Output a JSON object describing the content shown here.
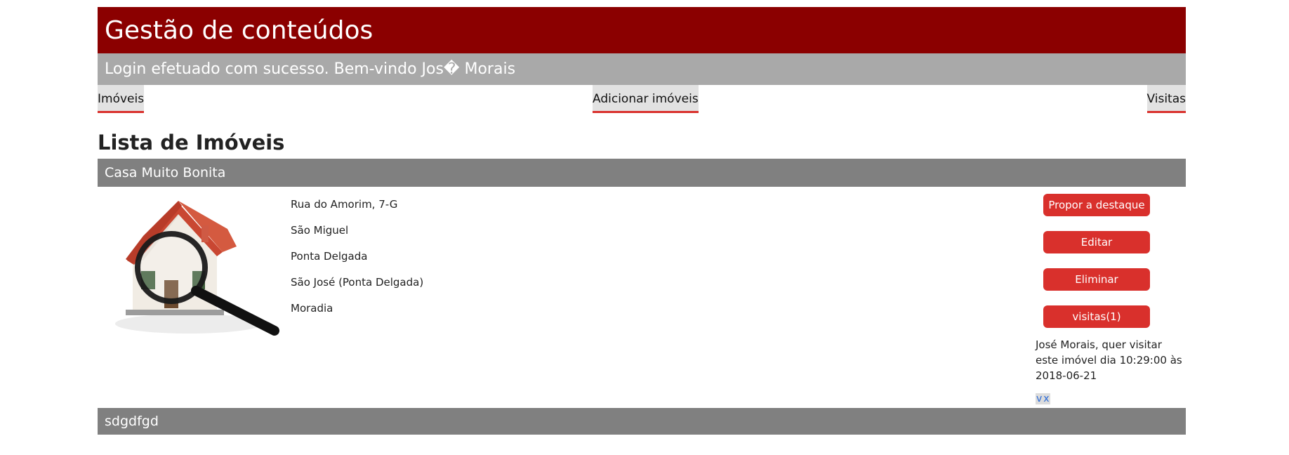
{
  "header": {
    "title": "Gestão de conteúdos"
  },
  "subheader": {
    "message": "Login efetuado com sucesso. Bem-vindo Jos� Morais"
  },
  "nav": {
    "items": [
      {
        "label": "Imóveis"
      },
      {
        "label": "Adicionar imóveis"
      },
      {
        "label": "Visitas"
      }
    ]
  },
  "main": {
    "title": "Lista de Imóveis",
    "listings": [
      {
        "title": "Casa Muito Bonita",
        "image": "house-magnifier-image",
        "details": [
          "Rua do Amorim, 7-G",
          "São Miguel",
          "Ponta Delgada",
          "São José (Ponta Delgada)",
          "Moradia"
        ],
        "actions": {
          "highlight": "Propor a destaque",
          "edit": "Editar",
          "delete": "Eliminar",
          "visits": "visitas(1)"
        },
        "visit_note": "José Morais, quer visitar este imóvel dia 10:29:00 às 2018-06-21",
        "visit_controls": {
          "accept": "v",
          "reject": "x"
        }
      },
      {
        "title": "sdgdfgd"
      }
    ]
  },
  "colors": {
    "header": "#8b0000",
    "subheader": "#a9a9a9",
    "listing_bar": "#808080",
    "button": "#d9302c",
    "nav_underline": "#d9302c"
  }
}
